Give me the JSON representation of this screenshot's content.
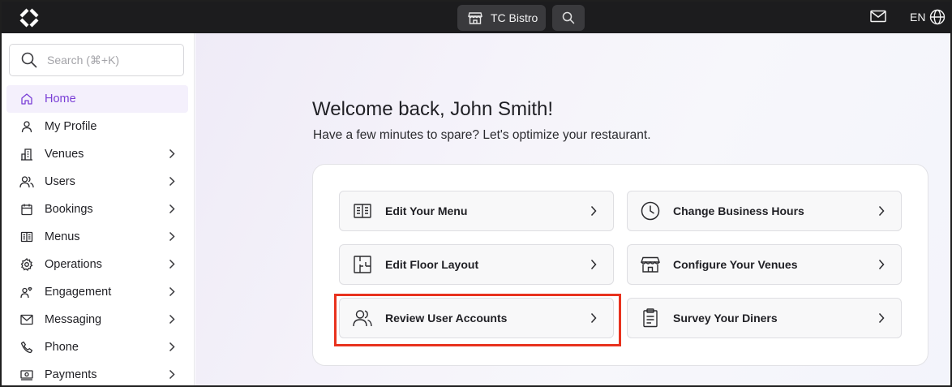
{
  "topbar": {
    "venue_name": "TC Bistro",
    "language": "EN"
  },
  "sidebar": {
    "search_placeholder": "Search (⌘+K)",
    "items": [
      {
        "label": "Home",
        "icon": "home-icon",
        "active": true,
        "has_submenu": false
      },
      {
        "label": "My Profile",
        "icon": "user-icon",
        "active": false,
        "has_submenu": false
      },
      {
        "label": "Venues",
        "icon": "building-icon",
        "active": false,
        "has_submenu": true
      },
      {
        "label": "Users",
        "icon": "users-icon",
        "active": false,
        "has_submenu": true
      },
      {
        "label": "Bookings",
        "icon": "calendar-icon",
        "active": false,
        "has_submenu": true
      },
      {
        "label": "Menus",
        "icon": "book-icon",
        "active": false,
        "has_submenu": true
      },
      {
        "label": "Operations",
        "icon": "gear-icon",
        "active": false,
        "has_submenu": true
      },
      {
        "label": "Engagement",
        "icon": "engagement-icon",
        "active": false,
        "has_submenu": true
      },
      {
        "label": "Messaging",
        "icon": "mail-icon",
        "active": false,
        "has_submenu": true
      },
      {
        "label": "Phone",
        "icon": "phone-icon",
        "active": false,
        "has_submenu": true
      },
      {
        "label": "Payments",
        "icon": "payment-icon",
        "active": false,
        "has_submenu": true
      }
    ]
  },
  "main": {
    "welcome": "Welcome back, John Smith!",
    "subtitle": "Have a few minutes to spare? Let's optimize your restaurant.",
    "actions": [
      {
        "label": "Edit Your Menu",
        "icon": "menu-book-icon"
      },
      {
        "label": "Change Business Hours",
        "icon": "clock-icon"
      },
      {
        "label": "Edit Floor Layout",
        "icon": "floor-plan-icon"
      },
      {
        "label": "Configure Your Venues",
        "icon": "storefront-icon"
      },
      {
        "label": "Review User Accounts",
        "icon": "users-icon",
        "highlighted": true
      },
      {
        "label": "Survey Your Diners",
        "icon": "clipboard-icon"
      }
    ]
  },
  "colors": {
    "accent": "#7a3fd6",
    "highlight_border": "#e8321e",
    "topbar_bg": "#1c1c1e"
  }
}
